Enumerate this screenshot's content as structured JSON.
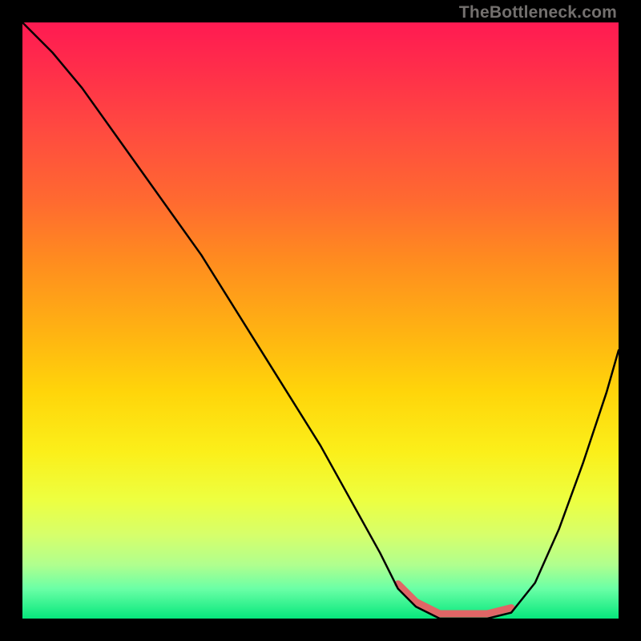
{
  "watermark": "TheBottleneck.com",
  "chart_data": {
    "type": "line",
    "title": "",
    "xlabel": "",
    "ylabel": "",
    "xlim": [
      0,
      100
    ],
    "ylim": [
      0,
      100
    ],
    "series": [
      {
        "name": "bottleneck-curve",
        "x": [
          0,
          5,
          10,
          15,
          20,
          25,
          30,
          35,
          40,
          45,
          50,
          55,
          60,
          63,
          66,
          70,
          74,
          78,
          82,
          86,
          90,
          94,
          98,
          100
        ],
        "y": [
          100,
          95,
          89,
          82,
          75,
          68,
          61,
          53,
          45,
          37,
          29,
          20,
          11,
          5,
          2,
          0,
          0,
          0,
          1,
          6,
          15,
          26,
          38,
          45
        ]
      }
    ],
    "annotations": [
      {
        "name": "plateau-marker",
        "x_start": 63,
        "x_end": 82,
        "color": "#e06666"
      }
    ],
    "background_gradient": [
      "#ff1a52",
      "#ffb312",
      "#fbef1a",
      "#06e77c"
    ]
  }
}
